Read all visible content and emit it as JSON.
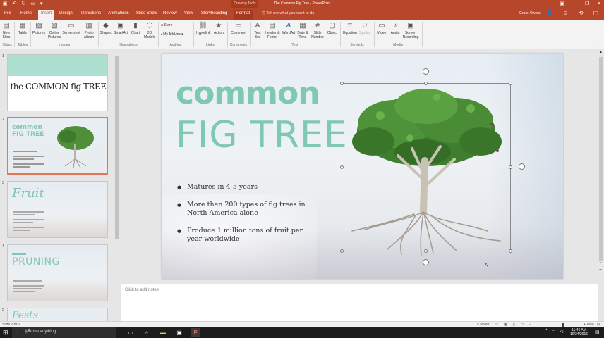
{
  "titlebar": {
    "context_label": "Drawing Tools",
    "document_title": "The Common Fig Tree - PowerPoint"
  },
  "tabs": [
    {
      "label": "File"
    },
    {
      "label": "Home"
    },
    {
      "label": "Insert"
    },
    {
      "label": "Design"
    },
    {
      "label": "Transitions"
    },
    {
      "label": "Animations"
    },
    {
      "label": "Slide Show"
    },
    {
      "label": "Review"
    },
    {
      "label": "View"
    },
    {
      "label": "Storyboarding"
    },
    {
      "label": "Format"
    }
  ],
  "tell_me": "Tell me what you want to do",
  "user_name": "Grace Owens",
  "ribbon": {
    "buttons": {
      "new_slide": "New Slide",
      "table": "Table",
      "pictures": "Pictures",
      "online_pictures": "Online Pictures",
      "screenshot": "Screenshot",
      "photo_album": "Photo Album",
      "shapes": "Shapes",
      "smartart": "SmartArt",
      "chart": "Chart",
      "models_3d": "3D Models",
      "store": "Store",
      "my_addins": "My Add-ins",
      "hyperlink": "Hyperlink",
      "action": "Action",
      "comment": "Comment",
      "text_box": "Text Box",
      "header_footer": "Header & Footer",
      "wordart": "WordArt",
      "date_time": "Date & Time",
      "slide_number": "Slide Number",
      "object": "Object",
      "equation": "Equation",
      "symbol": "Symbol",
      "video": "Video",
      "audio": "Audio",
      "screen_recording": "Screen Recording"
    },
    "groups": {
      "slides": "Slides",
      "tables": "Tables",
      "images": "Images",
      "illustrations": "Illustrations",
      "addins": "Add-ins",
      "links": "Links",
      "comments": "Comments",
      "text": "Text",
      "symbols": "Symbols",
      "media": "Media"
    }
  },
  "thumbnails": [
    {
      "number": "1",
      "title": "the COMMON fig TREE"
    },
    {
      "number": "2",
      "title": "common FIG TREE"
    },
    {
      "number": "3",
      "title": "Fruit"
    },
    {
      "number": "4",
      "title": "PRUNING"
    },
    {
      "number": "5",
      "title": "Pests"
    }
  ],
  "slide": {
    "title_line1": "common",
    "title_line2": "FIG TREE",
    "bullets": [
      "Matures in 4-5 years",
      "More than 200 types of fig trees in North America alone",
      "Produce 1 million tons of fruit per year worldwide"
    ]
  },
  "notes_placeholder": "Click to add notes",
  "statusbar": {
    "slide_count": "Slide 2 of 6",
    "notes_button": "Notes",
    "zoom": "89%"
  },
  "taskbar": {
    "search_placeholder": "Ask me anything",
    "time": "11:46 AM",
    "date": "10/24/2016"
  },
  "colors": {
    "accent": "#b7472a",
    "title_teal": "#7fc8b2"
  }
}
